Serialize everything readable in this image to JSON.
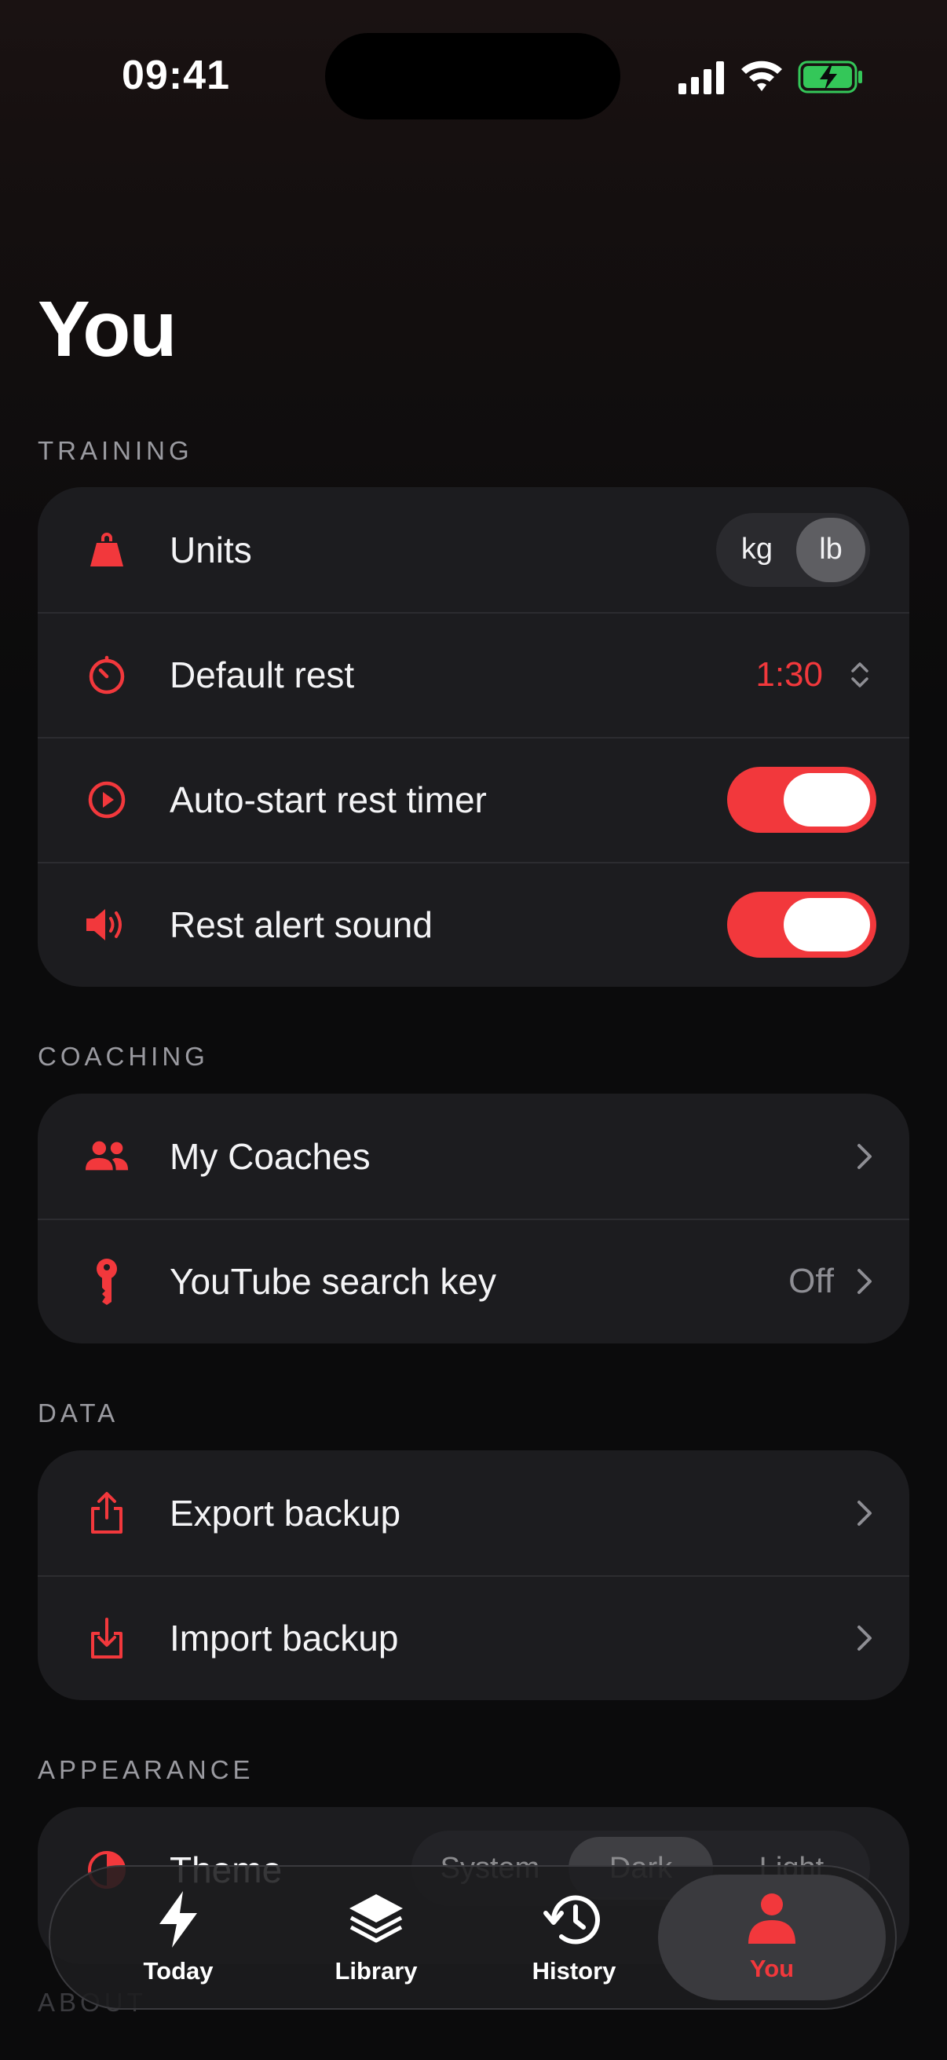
{
  "status": {
    "time": "09:41"
  },
  "page": {
    "title": "You"
  },
  "sections": {
    "training": {
      "label": "TRAINING",
      "units": {
        "label": "Units",
        "options": [
          "kg",
          "lb"
        ],
        "selected": "lb"
      },
      "default_rest": {
        "label": "Default rest",
        "value": "1:30"
      },
      "auto_start": {
        "label": "Auto-start rest timer",
        "on": true
      },
      "rest_alert": {
        "label": "Rest alert sound",
        "on": true
      }
    },
    "coaching": {
      "label": "COACHING",
      "my_coaches": {
        "label": "My Coaches"
      },
      "youtube_key": {
        "label": "YouTube search key",
        "value": "Off"
      }
    },
    "data": {
      "label": "DATA",
      "export": {
        "label": "Export backup"
      },
      "import": {
        "label": "Import backup"
      }
    },
    "appearance": {
      "label": "APPEARANCE",
      "theme": {
        "label": "Theme",
        "options": [
          "System",
          "Dark",
          "Light"
        ],
        "selected": "Dark"
      }
    },
    "about": {
      "label": "ABOUT"
    }
  },
  "tabbar": {
    "tabs": [
      {
        "label": "Today",
        "icon": "bolt-icon"
      },
      {
        "label": "Library",
        "icon": "layers-icon"
      },
      {
        "label": "History",
        "icon": "history-icon"
      },
      {
        "label": "You",
        "icon": "person-icon"
      }
    ],
    "active": "You"
  },
  "colors": {
    "accent": "#f2383c",
    "card": "#1c1c1f",
    "background": "#0b0b0c"
  }
}
